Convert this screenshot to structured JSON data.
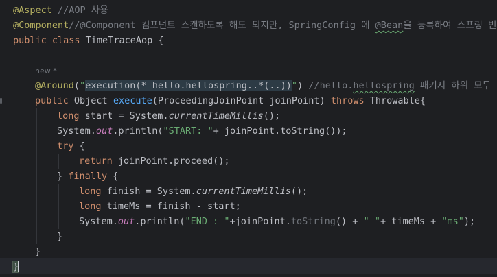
{
  "code": {
    "l1": {
      "ann": "@Aspect",
      "cmt": " //AOP 사용"
    },
    "l2": {
      "ann": "@Component",
      "cmt_a": "//@Component 컴포넌트 스캔하도록 해도 되지만, SpringConfig 에 ",
      "cmt_bean": "@Bean",
      "cmt_b": "을 등록하여 스프링 빈"
    },
    "l3": {
      "kw": "public class",
      "rest": " TimeTraceAop {"
    },
    "l5": {
      "hint": "new *"
    },
    "l6": {
      "ann": "@Around",
      "p1": "(",
      "str_open": "\"",
      "str_exec": "execution(* hello.hellospring..*(..))",
      "str_close": "\"",
      "p2": ")",
      "cmt_a": " //hello.",
      "cmt_sq": "hellospring",
      "cmt_b": " 패키지 하위 모두 적"
    },
    "l7": {
      "kw": "public",
      "t1": " Object ",
      "fn": "execute",
      "t2": "(ProceedingJoinPoint joinPoint) ",
      "kw2": "throws",
      "t3": " Throwable{"
    },
    "l8": {
      "kw": "long",
      "t1": " start = System.",
      "sfn": "currentTimeMillis",
      "t2": "();"
    },
    "l9": {
      "t1": "System.",
      "stat": "out",
      "t2": ".println(",
      "str": "\"START: \"",
      "t3": "+ joinPoint.toString());"
    },
    "l10": {
      "kw": "try",
      "t1": " {"
    },
    "l11": {
      "kw": "return",
      "t1": " joinPoint.proceed();"
    },
    "l12": {
      "t1": "} ",
      "kw": "finally",
      "t2": " {"
    },
    "l13": {
      "kw": "long",
      "t1": " finish = System.",
      "sfn": "currentTimeMillis",
      "t2": "();"
    },
    "l14": {
      "kw": "long",
      "t1": " timeMs = finish - start;"
    },
    "l15": {
      "t1": "System.",
      "stat": "out",
      "t2": ".println(",
      "str": "\"END : \"",
      "t3": "+joinPoint.",
      "dim": "toString",
      "t4": "() + ",
      "str2": "\" \"",
      "t5": "+ timeMs + ",
      "str3": "\"ms\"",
      "t6": ");"
    },
    "l16": {
      "t1": "}"
    },
    "l17": {
      "t1": "}"
    },
    "l18": {
      "t1": "}"
    }
  },
  "colors": {
    "background": "#1e1f22",
    "keyword": "#cf8e6d",
    "annotation": "#b3ae60",
    "comment": "#7a7e85",
    "string": "#6aab73",
    "function": "#56a8f5",
    "static_field": "#c77dbb"
  }
}
